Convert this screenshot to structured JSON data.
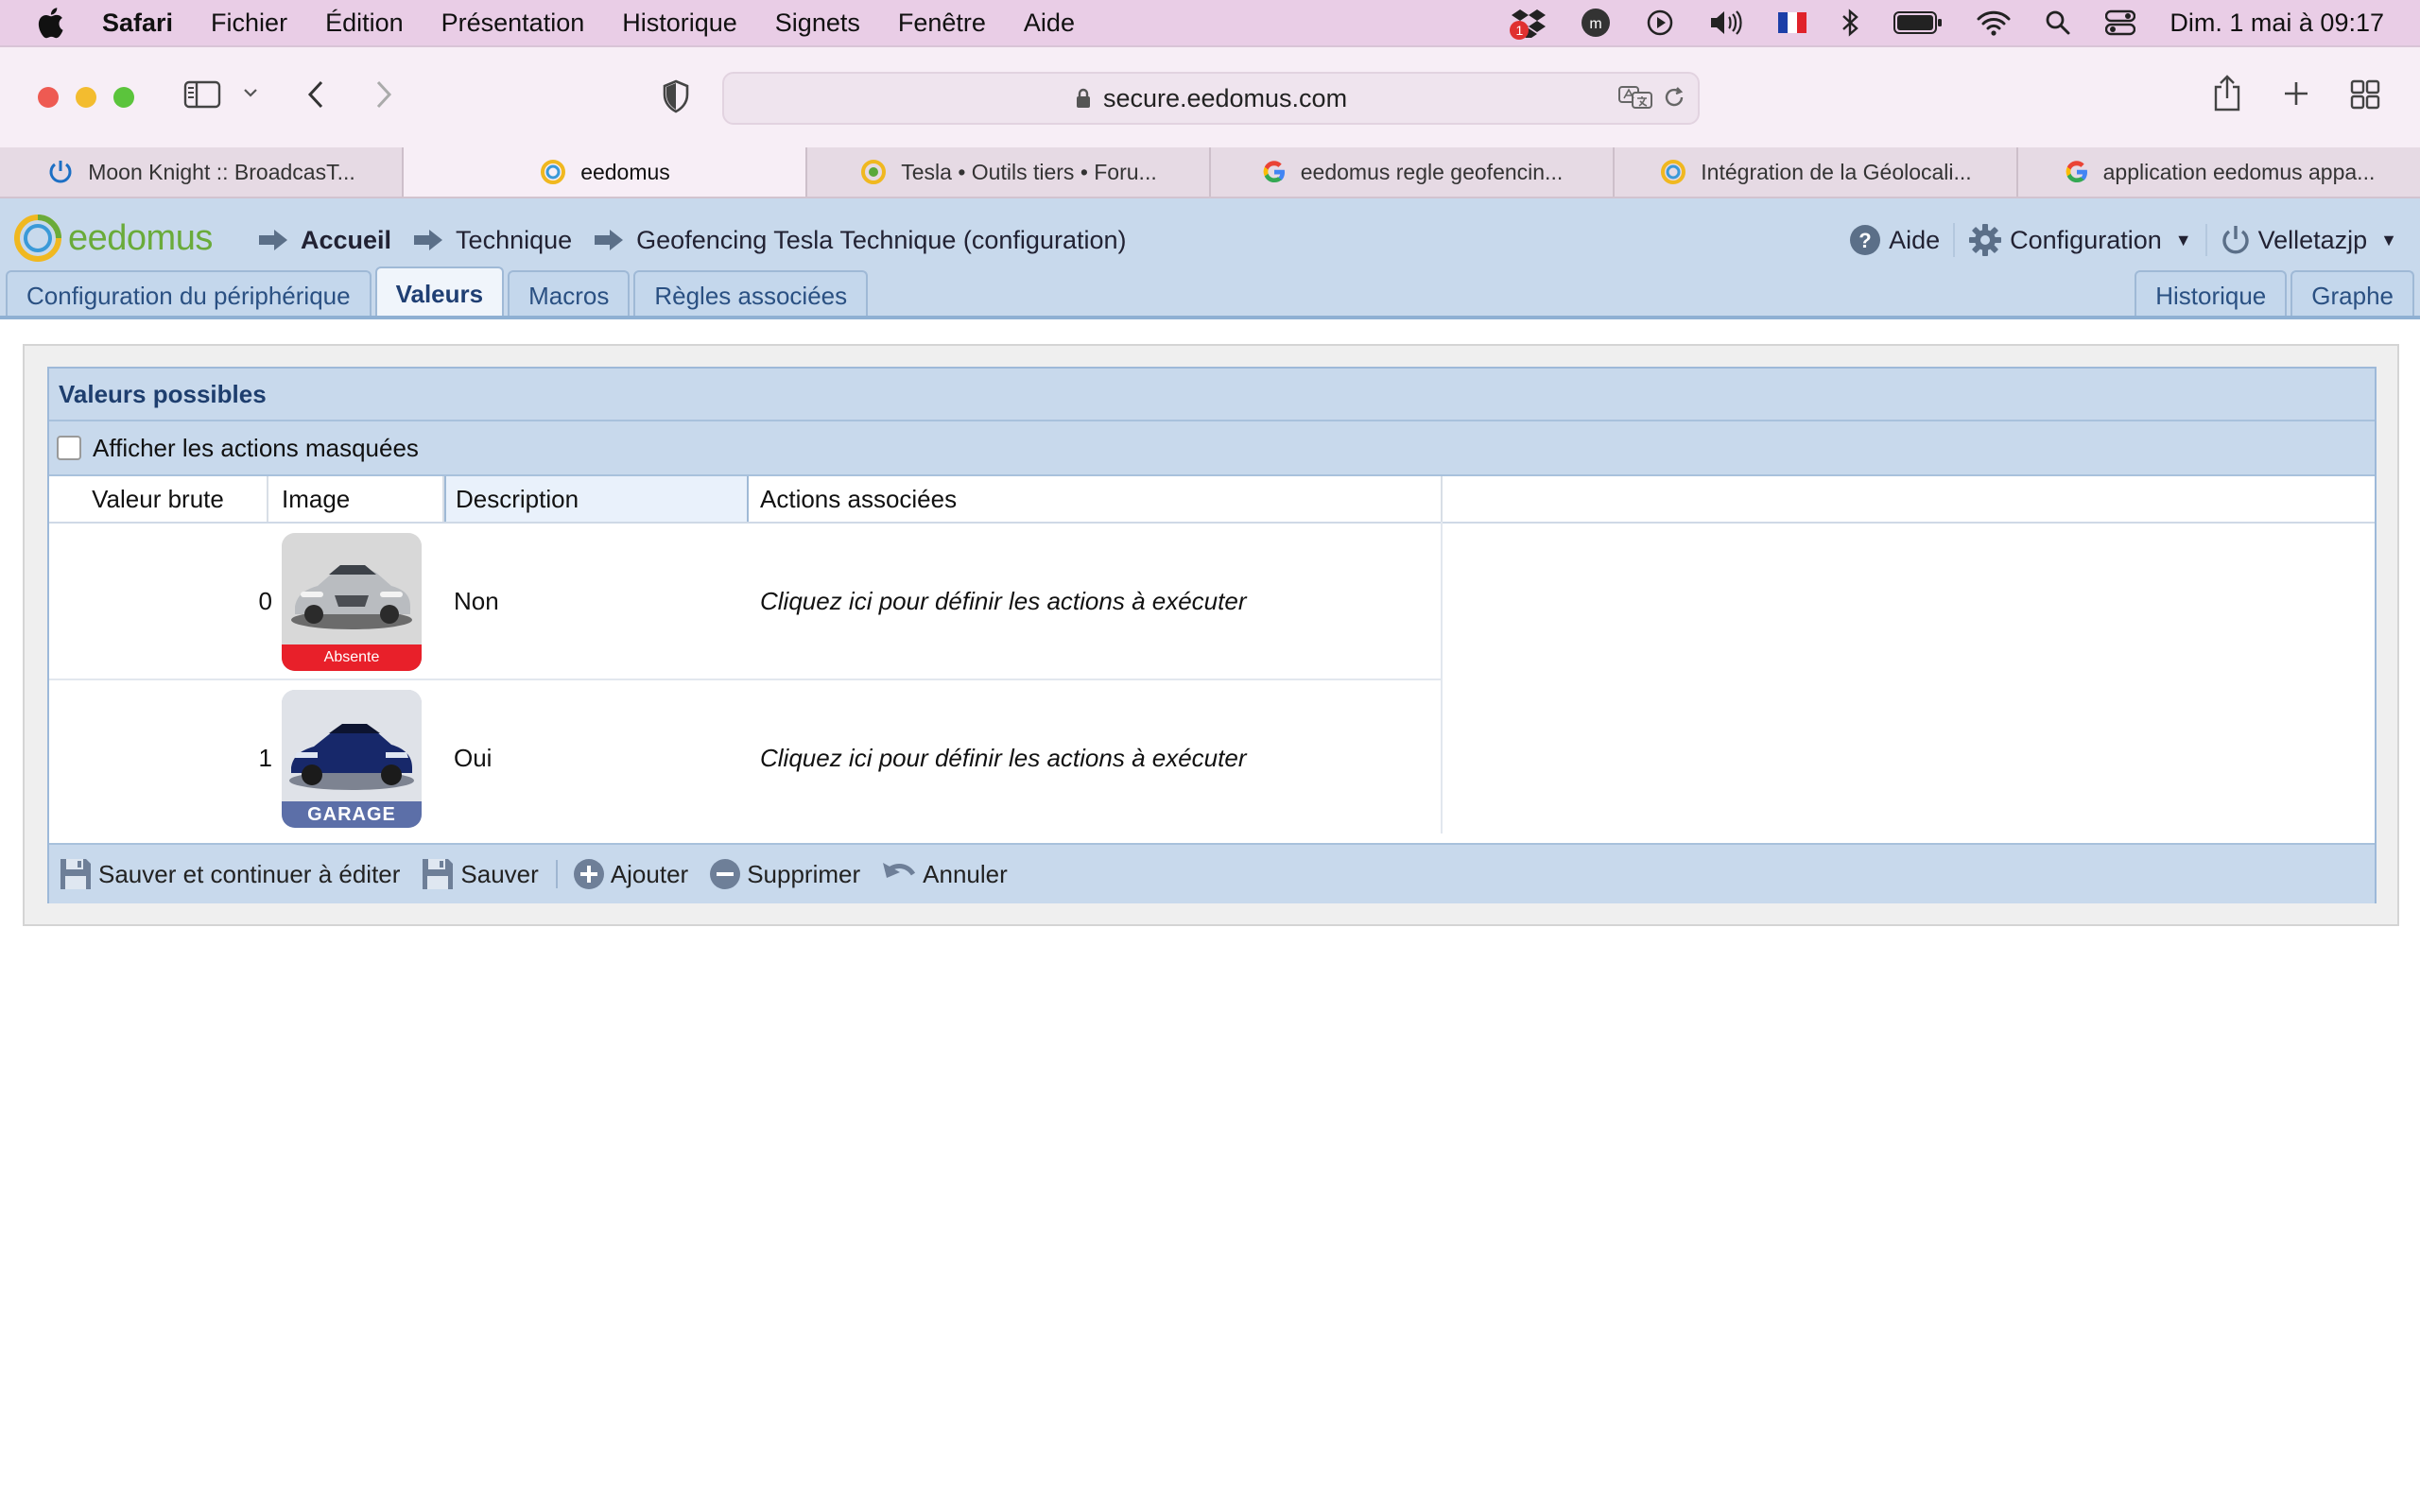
{
  "menubar": {
    "app": "Safari",
    "items": [
      "Fichier",
      "Édition",
      "Présentation",
      "Historique",
      "Signets",
      "Fenêtre",
      "Aide"
    ],
    "clock": "Dim. 1 mai à  09:17",
    "badge": "1"
  },
  "browser": {
    "url": "secure.eedomus.com",
    "tabs": [
      {
        "title": "Moon Knight :: BroadcasT..."
      },
      {
        "title": "eedomus"
      },
      {
        "title": "Tesla • Outils tiers • Foru..."
      },
      {
        "title": "eedomus regle geofencin..."
      },
      {
        "title": "Intégration de la Géolocali..."
      },
      {
        "title": "application eedomus appa..."
      }
    ]
  },
  "app": {
    "logo": "eedomus",
    "breadcrumbs": [
      "Accueil",
      "Technique",
      "Geofencing Tesla Technique (configuration)"
    ],
    "help": "Aide",
    "configuration": "Configuration",
    "user": "Velletazjp",
    "tabs": [
      "Configuration du périphérique",
      "Valeurs",
      "Macros",
      "Règles associées"
    ],
    "right_tabs": [
      "Historique",
      "Graphe"
    ]
  },
  "panel": {
    "title": "Valeurs possibles",
    "show_masked": "Afficher les actions masquées",
    "columns": [
      "Valeur brute",
      "Image",
      "Description",
      "Actions associées"
    ],
    "rows": [
      {
        "raw": "0",
        "image_label": "Absente",
        "description": "Non",
        "action": "Cliquez ici pour définir les actions à exécuter"
      },
      {
        "raw": "1",
        "image_label": "GARAGE",
        "description": "Oui",
        "action": "Cliquez ici pour définir les actions à exécuter"
      }
    ],
    "buttons": {
      "save_continue": "Sauver et continuer à éditer",
      "save": "Sauver",
      "add": "Ajouter",
      "delete": "Supprimer",
      "cancel": "Annuler"
    }
  },
  "colors": {
    "menubar": "#e9cde6",
    "header": "#c8d9ec",
    "accent_blue": "#2a5082",
    "logo_green": "#6aab3a",
    "absent_red": "#e8202a",
    "garage_blue": "#5c6fa8"
  }
}
